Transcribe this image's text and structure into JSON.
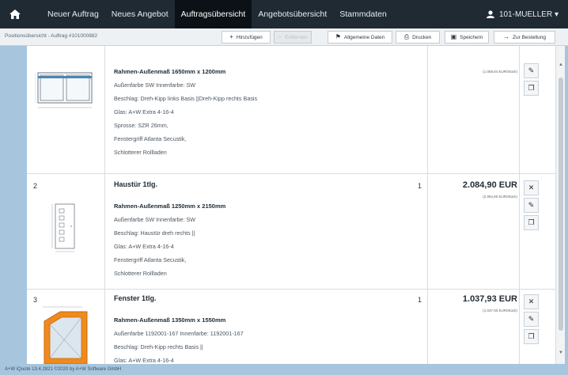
{
  "nav": {
    "items": [
      "Neuer Auftrag",
      "Neues Angebot",
      "Auftragsübersicht",
      "Angebotsübersicht",
      "Stammdaten"
    ],
    "active_index": 2,
    "user": "101-MUELLER ▾"
  },
  "toolbar": {
    "breadcrumb": "Positionsübersicht - Auftrag #101000882",
    "buttons": [
      {
        "label": "Hinzufügen",
        "icon": "plus-icon",
        "glyph": "+",
        "disabled": false
      },
      {
        "label": "Entfernen",
        "icon": "minus-icon",
        "glyph": "–",
        "disabled": true
      },
      {
        "label": "Allgemeine Daten",
        "icon": "flag-icon",
        "glyph": "⚑",
        "disabled": false
      },
      {
        "label": "Drucken",
        "icon": "print-icon",
        "glyph": "⎙",
        "disabled": false
      },
      {
        "label": "Speichern",
        "icon": "save-icon",
        "glyph": "▣",
        "disabled": false
      },
      {
        "label": "Zur Bestellung",
        "icon": "arrow-right-icon",
        "glyph": "→",
        "disabled": false
      }
    ]
  },
  "rows": [
    {
      "pos": "",
      "title": "",
      "qty": "",
      "price": "",
      "unit_price": "(1.059,64 EUR/Stück)",
      "lines": [
        {
          "text": "Rahmen-Außenmaß 1650mm x 1200mm",
          "bold": true
        },
        {
          "text": "Außenfarbe SW Innenfarbe: SW",
          "bold": false
        },
        {
          "text": "Beschlag: Dreh-Kipp links Basis ||Dreh-Kipp rechts Basis",
          "bold": false
        },
        {
          "text": "Glas: A+W Extra 4-16-4",
          "bold": false
        },
        {
          "text": "Sprosse: SZR 26mm,",
          "bold": false
        },
        {
          "text": "Fenstergriff Atlanta Secustik,",
          "bold": false
        },
        {
          "text": "Schlotterer Rollladen",
          "bold": false
        }
      ]
    },
    {
      "pos": "2",
      "title": "Haustür 1tlg.",
      "qty": "1",
      "price": "2.084,90 EUR",
      "unit_price": "(2.084,90 EUR/Stück)",
      "lines": [
        {
          "text": "Rahmen-Außenmaß 1250mm x 2150mm",
          "bold": true
        },
        {
          "text": "Außenfarbe SW Innenfarbe: SW",
          "bold": false
        },
        {
          "text": "Beschlag: Haustür dreh rechts ||",
          "bold": false
        },
        {
          "text": "Glas: A+W Extra 4-16-4",
          "bold": false
        },
        {
          "text": "Fenstergriff Atlanta Secustik,",
          "bold": false
        },
        {
          "text": "Schlotterer Rollladen",
          "bold": false
        }
      ]
    },
    {
      "pos": "3",
      "title": "Fenster 1tlg.",
      "qty": "1",
      "price": "1.037,93 EUR",
      "unit_price": "(1.037,93 EUR/Stück)",
      "lines": [
        {
          "text": "Rahmen-Außenmaß 1350mm x 1550mm",
          "bold": true
        },
        {
          "text": "Außenfarbe 1192001-167 Innenfarbe: 1192001-167",
          "bold": false
        },
        {
          "text": "Beschlag: Dreh-Kipp rechts Basis ||",
          "bold": false
        },
        {
          "text": "Glas: A+W Extra 4-16-4",
          "bold": false
        }
      ]
    }
  ],
  "actions": [
    {
      "name": "delete-icon",
      "glyph": "✕"
    },
    {
      "name": "edit-icon",
      "glyph": "✎"
    },
    {
      "name": "copy-icon",
      "glyph": "❐"
    }
  ],
  "footer": "A+W iQuote 13.4.2821 ©2020 by A+W Software GmbH",
  "colors": {
    "nav_bg": "#1f2a33",
    "nav_active": "#0b1116",
    "window_frame": "#e58a1f",
    "page_bg": "#a7c6de"
  }
}
